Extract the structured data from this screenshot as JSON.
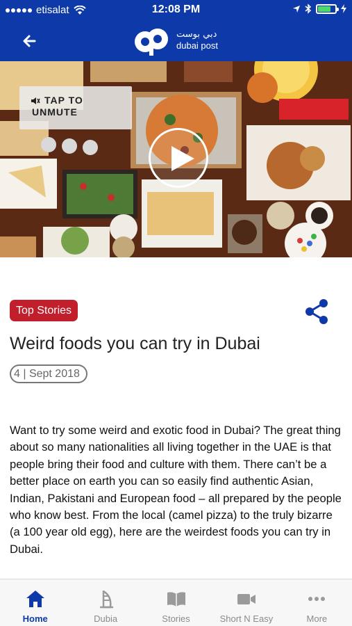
{
  "status_bar": {
    "carrier": "etisalat",
    "time": "12:08 PM"
  },
  "header": {
    "logo_arabic": "دبي بوست",
    "logo_english": "dubai post",
    "back_icon": "arrow-left-icon"
  },
  "video": {
    "mute_label": "TAP TO UNMUTE",
    "play_icon": "play-icon"
  },
  "article": {
    "category": "Top Stories",
    "title": "Weird foods you can try in Dubai",
    "date": "4 | Sept 2018",
    "body": "Want to try some weird and exotic food in Dubai? The great thing about so many nationalities all living together in the UAE is that people bring their food and culture with them. There can’t be a better place on earth you can so easily find authentic Asian, Indian, Pakistani and European food – all prepared by the people who know best. From the local (camel pizza) to the truly bizarre (a 100 year old egg), here are the weirdest foods you can try in Dubai."
  },
  "tabs": [
    {
      "label": "Home",
      "icon": "home-icon",
      "active": true
    },
    {
      "label": "Dubia",
      "icon": "burj-al-arab-icon",
      "active": false
    },
    {
      "label": "Stories",
      "icon": "book-icon",
      "active": false
    },
    {
      "label": "Short N Easy",
      "icon": "video-camera-icon",
      "active": false
    },
    {
      "label": "More",
      "icon": "more-dots-icon",
      "active": false
    }
  ],
  "colors": {
    "brand_blue": "#0d3aa8",
    "badge_red": "#c11f2b"
  }
}
